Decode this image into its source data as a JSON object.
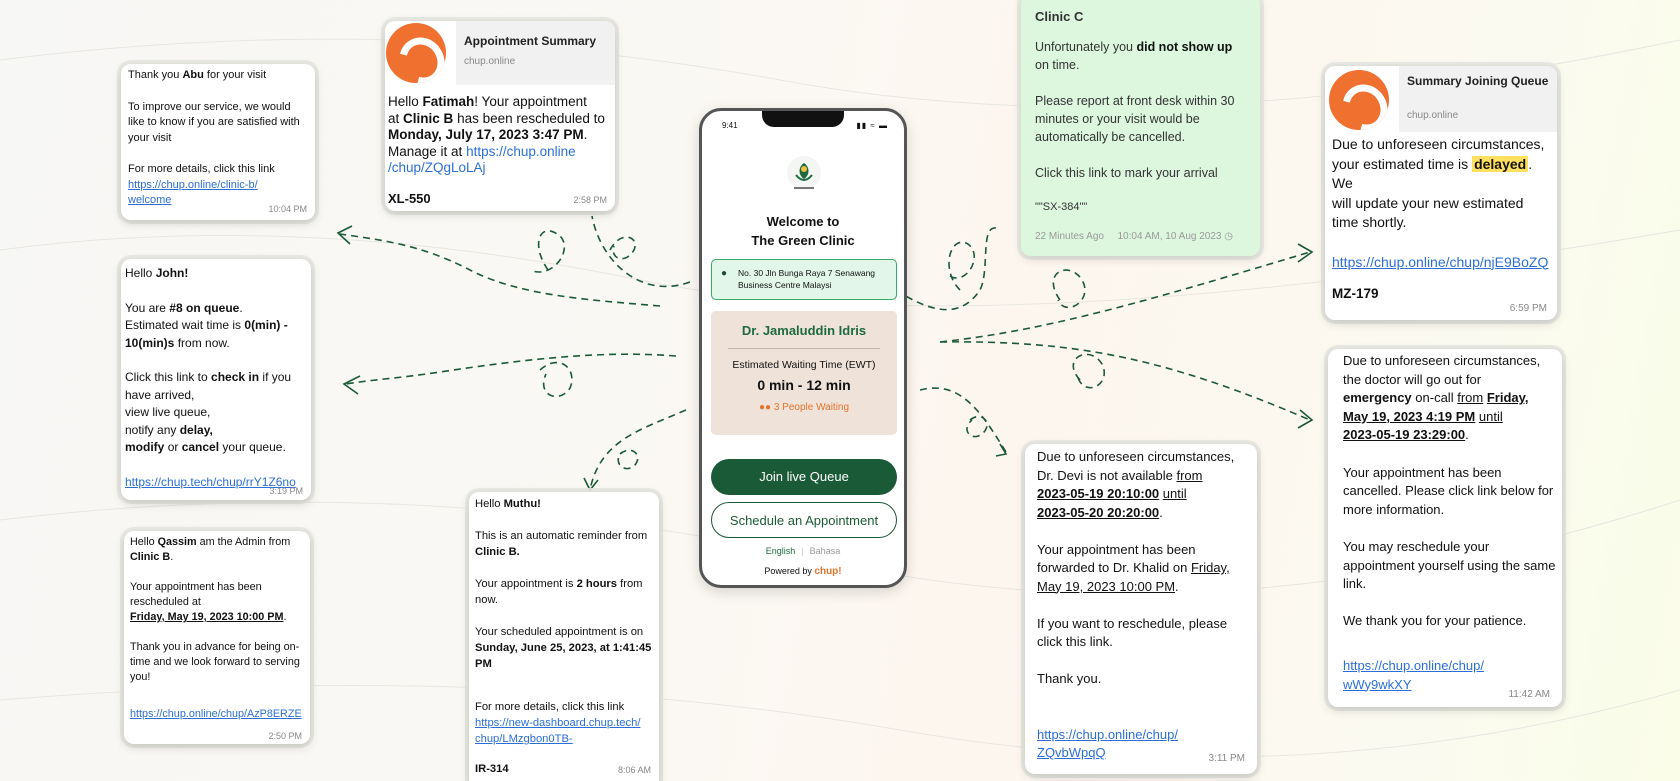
{
  "cards": {
    "abu": {
      "greeting_prefix": "Thank you",
      "name": "Abu",
      "greeting_suffix": "for your visit",
      "body": "To improve our service, we would like to know if you are satisfied with your visit",
      "details": "For more details, click this link",
      "link_line1": "https://chup.online/clinic-b/",
      "link_line2": "welcome",
      "time": "10:04 PM"
    },
    "summary": {
      "title": "Appointment Summary",
      "domain": "chup.online",
      "hello": "Hello",
      "name": "Fatimah",
      "line1_suffix": "! Your appointment",
      "at": "at",
      "clinic": "Clinic B",
      "rescheduled": "has been rescheduled to",
      "date": "Monday, July 17, 2023 3:47 PM",
      "manage": "Manage it at",
      "link_line1": "https://chup.online",
      "link_line2": "/chup/ZQgLoLAj",
      "code": "XL-550",
      "time": "2:58 PM"
    },
    "john": {
      "hello": "Hello",
      "name": "John!",
      "queue_prefix": "You are",
      "queue_num": "#8",
      "queue_suffix": "on queue",
      "wait_prefix": "Estimated wait time is",
      "wait_range_a": "0(min) -",
      "wait_range_b": "10(min)s",
      "wait_suffix": "from now.",
      "click_prefix": "Click this link to",
      "check_in": "check in",
      "click_suffix": "if you",
      "arrived": "have arrived,",
      "view": "view live queue,",
      "notify_prefix": "notify any",
      "delay": "delay,",
      "modify": "modify",
      "or": "or",
      "cancel": "cancel",
      "queue_end": "your queue.",
      "link": "https://chup.tech/chup/rrY1Z6no",
      "time": "3:19 PM"
    },
    "qassim": {
      "hello": "Hello",
      "name": "Qassim",
      "admin": "am the Admin from",
      "clinic": "Clinic B",
      "resched1": "Your appointment has been",
      "resched2": "rescheduled at",
      "date": "Friday, May 19, 2023 10:00 PM",
      "thanks": "Thank you in advance for being on-time and we look forward to serving you!",
      "link": "https://chup.online/chup/AzP8ERZE",
      "time": "2:50 PM"
    },
    "muthu": {
      "hello": "Hello",
      "name": "Muthu!",
      "auto": "This is an automatic reminder from",
      "clinic": "Clinic B.",
      "appt_prefix": "Your appointment is",
      "hours": "2 hours",
      "appt_suffix": "from",
      "now": "now.",
      "sched": "Your scheduled appointment is on",
      "date": "Sunday, June 25, 2023, at 1:41:45 PM",
      "details": "For more details, click this link",
      "link_line1": "https://new-dashboard.chup.tech/",
      "link_line2": "chup/LMzgbon0TB-",
      "code": "IR-314",
      "time": "8:06 AM"
    },
    "clinic_c": {
      "title": "Clinic C",
      "unfortunately": "Unfortunately you",
      "noshow": "did not show up",
      "ontime": "on time.",
      "report": "Please report at front desk within 30 minutes or your visit would be automatically be cancelled.",
      "mark": "Click this link to mark your arrival",
      "code": "\"\"SX-384\"\"",
      "ago": "22 Minutes Ago",
      "stamp": "10:04 AM, 10 Aug 2023"
    },
    "devi": {
      "intro": "Due to unforeseen circumstances,",
      "line2_prefix": "Dr. Devi is not available",
      "from": "from",
      "from_date": "2023-05-19 20:10:00",
      "until": "until",
      "until_date": "2023-05-20 20:20:00",
      "fwd1": "Your appointment has been",
      "fwd2_prefix": "forwarded to Dr. Khalid on",
      "fwd2_date": "Friday,",
      "fwd3": "May 19, 2023 10:00 PM",
      "resched": "If you want to reschedule, please click this link.",
      "thanks": "Thank you.",
      "link_line1": "https://chup.online/chup/",
      "link_line2": "ZQvbWpqQ",
      "time": "3:11 PM"
    },
    "joining": {
      "title": "Summary Joining Queue",
      "domain": "chup.online",
      "line1": "Due to unforeseen circumstances,",
      "line2_prefix": "your estimated time is",
      "delayed": "delayed",
      "line2_suffix": ". We",
      "line3": "will update your new estimated time shortly.",
      "link": "https://chup.online/chup/njE9BoZQ",
      "code": "MZ-179",
      "time": "6:59 PM"
    },
    "cancelled": {
      "line1": "Due to unforeseen circumstances, the doctor will go out for",
      "emergency": "emergency",
      "oncall": "on-call",
      "from": "from",
      "from_date": "Friday, May 19, 2023 4:19 PM",
      "until": "until",
      "until_date": "2023-05-19 23:29:00",
      "cancel": "Your appointment has been cancelled. Please click link below for more information.",
      "resched": "You may reschedule your appointment yourself using the same link.",
      "thanks": "We thank you for your patience.",
      "link_line1": "https://chup.online/chup/",
      "link_line2": "wWy9wkXY",
      "time": "11:42 AM"
    }
  },
  "phone": {
    "status_time": "9:41",
    "welcome_line1": "Welcome to",
    "welcome_line2": "The Green Clinic",
    "address": "No. 30 Jln Bunga Raya 7 Senawang Business Centre Malaysi",
    "doctor": "Dr. Jamaluddin Idris",
    "ewt_label": "Estimated Waiting Time (EWT)",
    "ewt_range": "0 min - 12 min",
    "waiting": "3 People Waiting",
    "join_label": "Join live Queue",
    "schedule_label": "Schedule an Appointment",
    "lang_en": "English",
    "lang_bm": "Bahasa",
    "powered_by": "Powered by",
    "brand": "chup!"
  },
  "colors": {
    "primary_green": "#1b5a37",
    "link_blue": "#2b6fd6",
    "accent_orange": "#e2742e",
    "highlight_yellow": "#ffdf5e"
  }
}
